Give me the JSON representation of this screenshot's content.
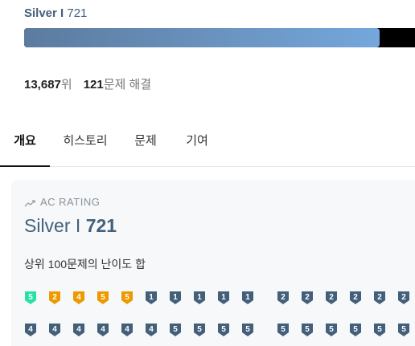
{
  "header": {
    "tier_name": "Silver I",
    "rating": "721",
    "progress_fraction": 0.91
  },
  "stats": {
    "rank_value": "13,687",
    "rank_suffix": "위",
    "solved_value": "121",
    "solved_suffix": "문제 해결"
  },
  "tabs": [
    {
      "label": "개요",
      "active": true
    },
    {
      "label": "히스토리",
      "active": false
    },
    {
      "label": "문제",
      "active": false
    },
    {
      "label": "기여",
      "active": false
    }
  ],
  "card": {
    "label": "AC RATING",
    "tier_name": "Silver I",
    "rating": "721",
    "description": "상위 100문제의 난이도 합"
  },
  "badge_rows": [
    [
      "5",
      "2",
      "4",
      "5",
      "5",
      "1",
      "1",
      "1",
      "1",
      "1",
      "2",
      "2",
      "2",
      "2",
      "2",
      "2"
    ],
    [
      "4",
      "4",
      "4",
      "4",
      "4",
      "4",
      "5",
      "5",
      "5",
      "5",
      "5",
      "5",
      "5",
      "5",
      "5",
      "5"
    ]
  ],
  "badge_tiers": [
    [
      "silver",
      "bronze",
      "bronze",
      "bronze",
      "bronze",
      "bronze-dark",
      "bronze-dark",
      "bronze-dark",
      "bronze-dark",
      "bronze-dark",
      "bronze-dark",
      "bronze-dark",
      "bronze-dark",
      "bronze-dark",
      "bronze-dark",
      "bronze-dark"
    ],
    [
      "bronze-dark",
      "bronze-dark",
      "bronze-dark",
      "bronze-dark",
      "bronze-dark",
      "bronze-dark",
      "bronze-dark",
      "bronze-dark",
      "bronze-dark",
      "bronze-dark",
      "bronze-dark",
      "bronze-dark",
      "bronze-dark",
      "bronze-dark",
      "bronze-dark",
      "bronze-dark"
    ]
  ],
  "colors": {
    "tier_text": "#435f7a",
    "badge_green": "#27e2a4",
    "badge_orange": "#ec9a00",
    "badge_slate": "#435f7a"
  }
}
